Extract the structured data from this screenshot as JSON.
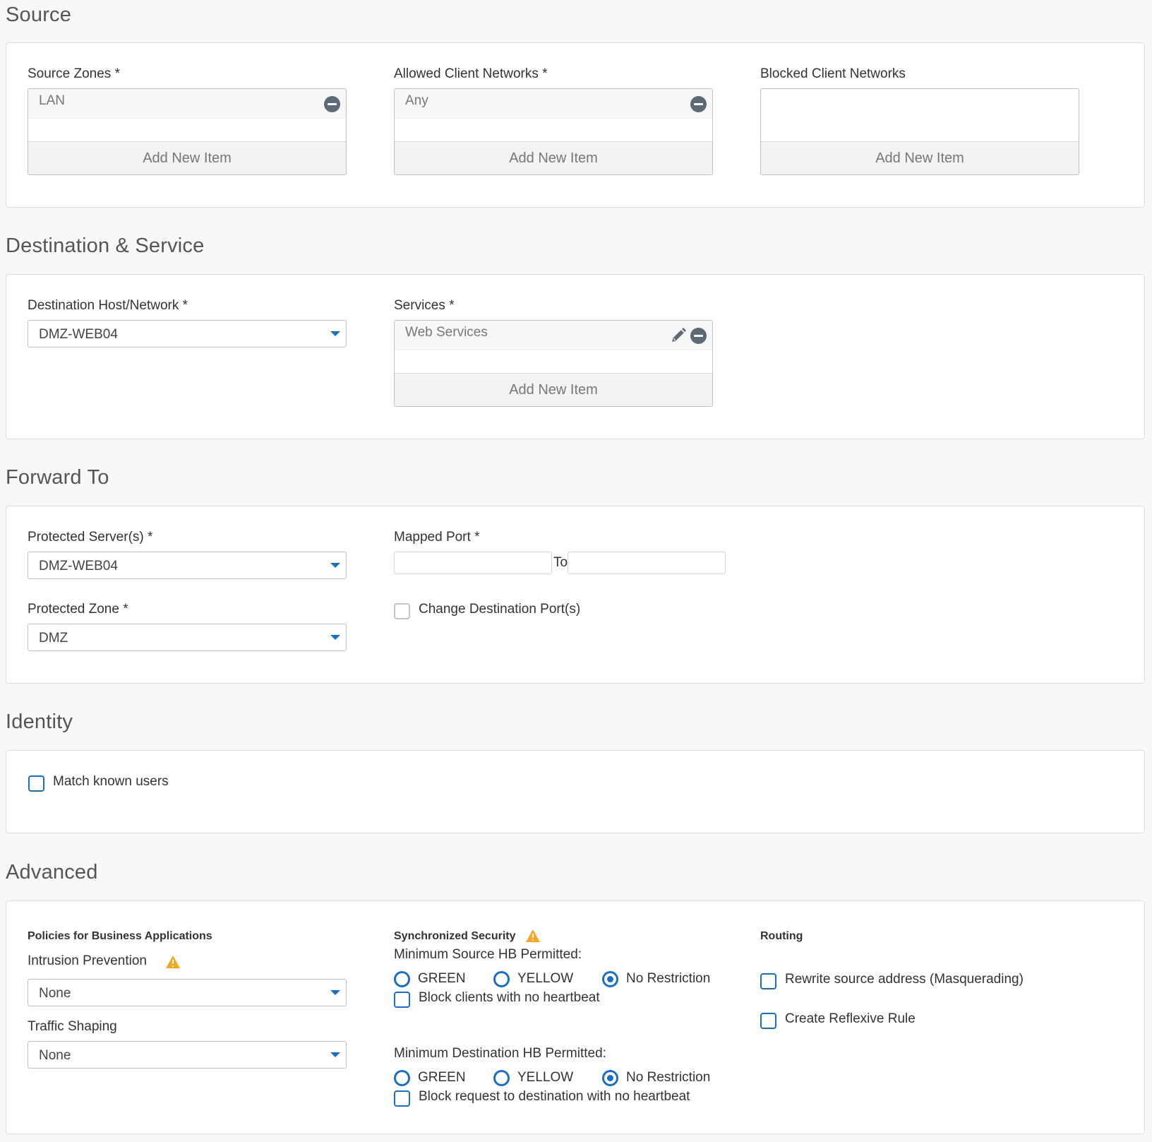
{
  "source": {
    "title": "Source",
    "source_zones": {
      "label": "Source Zones *",
      "items": [
        "LAN"
      ],
      "add_label": "Add New Item"
    },
    "allowed_networks": {
      "label": "Allowed Client Networks *",
      "items": [
        "Any"
      ],
      "add_label": "Add New Item"
    },
    "blocked_networks": {
      "label": "Blocked Client Networks",
      "items": [],
      "add_label": "Add New Item"
    }
  },
  "destination": {
    "title": "Destination & Service",
    "host_label": "Destination Host/Network *",
    "host_value": "DMZ-WEB04",
    "services": {
      "label": "Services *",
      "items": [
        "Web Services"
      ],
      "add_label": "Add New Item"
    }
  },
  "forward": {
    "title": "Forward To",
    "servers_label": "Protected Server(s) *",
    "servers_value": "DMZ-WEB04",
    "zone_label": "Protected Zone *",
    "zone_value": "DMZ",
    "mapped_port_label": "Mapped Port *",
    "mapped_port_from": "",
    "mapped_port_to_label": "To",
    "mapped_port_to": "",
    "change_port_label": "Change Destination Port(s)",
    "change_port_checked": false
  },
  "identity": {
    "title": "Identity",
    "match_users_label": "Match known users",
    "match_users_checked": false
  },
  "advanced": {
    "title": "Advanced",
    "policies_heading": "Policies for Business Applications",
    "ips_label": "Intrusion Prevention",
    "ips_value": "None",
    "shaping_label": "Traffic Shaping",
    "shaping_value": "None",
    "sync_heading": "Synchronized Security",
    "min_source_label": "Minimum Source HB Permitted:",
    "min_dest_label": "Minimum Destination HB Permitted:",
    "hb_options": [
      "GREEN",
      "YELLOW",
      "No Restriction"
    ],
    "hb_source_selected": "No Restriction",
    "hb_dest_selected": "No Restriction",
    "block_clients_label": "Block clients with no heartbeat",
    "block_dest_label": "Block request to destination with no heartbeat",
    "routing_heading": "Routing",
    "masquerade_label": "Rewrite source address (Masquerading)",
    "reflexive_label": "Create Reflexive Rule"
  },
  "colors": {
    "accent": "#1a6fc4",
    "warning": "#f5a623",
    "remove_icon": "#5d6a78"
  }
}
